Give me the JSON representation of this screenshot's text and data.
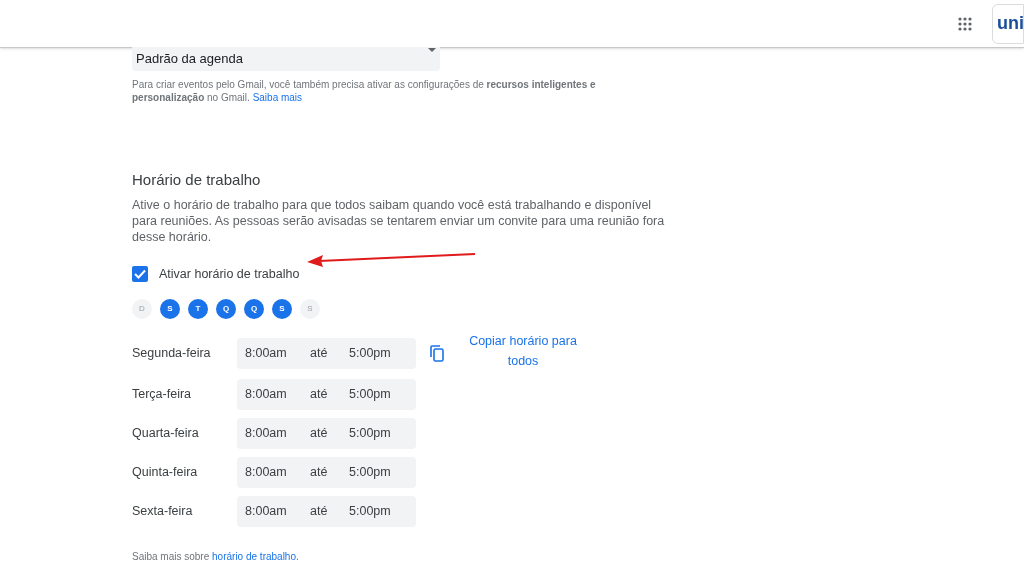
{
  "header": {
    "logo_text": "uni"
  },
  "event_dropdown": {
    "value": "Padrão da agenda"
  },
  "gmail_note": {
    "text": "Para criar eventos pelo Gmail, você também precisa ativar as configurações de **recursos inteligentes e personalização** no Gmail.",
    "link": "Saiba mais"
  },
  "working_hours": {
    "title": "Horário de trabalho",
    "description": "Ative o horário de trabalho para que todos saibam quando você está trabalhando e disponível para reuniões. As pessoas serão avisadas se tentarem enviar um convite para uma reunião fora desse horário.",
    "enable": {
      "label": "Ativar horário de trabalho",
      "checked": true
    },
    "days": [
      {
        "label": "D",
        "selected": false
      },
      {
        "label": "S",
        "selected": true
      },
      {
        "label": "T",
        "selected": true
      },
      {
        "label": "Q",
        "selected": true
      },
      {
        "label": "Q",
        "selected": true
      },
      {
        "label": "S",
        "selected": true
      },
      {
        "label": "S",
        "selected": false
      }
    ],
    "schedule": [
      {
        "day": "Segunda-feira",
        "start": "8:00am",
        "separator": "até",
        "end": "5:00pm"
      },
      {
        "day": "Terça-feira",
        "start": "8:00am",
        "separator": "até",
        "end": "5:00pm"
      },
      {
        "day": "Quarta-feira",
        "start": "8:00am",
        "separator": "até",
        "end": "5:00pm"
      },
      {
        "day": "Quinta-feira",
        "start": "8:00am",
        "separator": "até",
        "end": "5:00pm"
      },
      {
        "day": "Sexta-feira",
        "start": "8:00am",
        "separator": "até",
        "end": "5:00pm"
      }
    ],
    "copy_link": "Copiar horário para todos",
    "footer": {
      "text": "Saiba mais sobre",
      "link": "horário de trabalho."
    }
  }
}
